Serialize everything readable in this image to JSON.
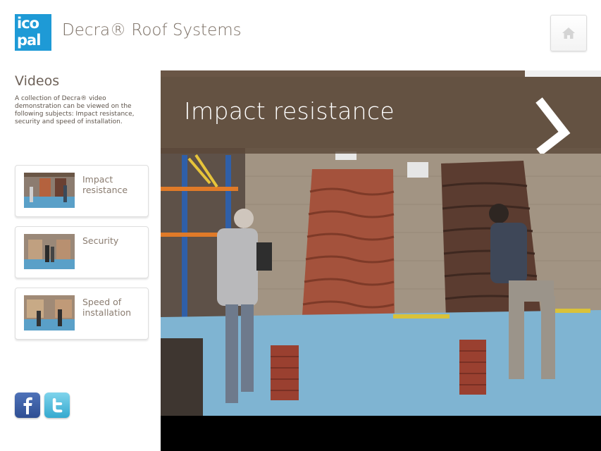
{
  "header": {
    "logo_line1": "ico",
    "logo_line2": "pal",
    "app_title": "Decra® Roof Systems",
    "home_icon": "home-icon"
  },
  "sidebar": {
    "title": "Videos",
    "description": "A collection of Decra® video demonstration can be viewed on the following subjects: Impact resistance, security and speed of installation.",
    "items": [
      {
        "label": "Impact resistance"
      },
      {
        "label": "Security"
      },
      {
        "label": "Speed of installation"
      }
    ],
    "social": [
      {
        "icon": "facebook-icon"
      },
      {
        "icon": "twitter-icon"
      }
    ]
  },
  "player": {
    "title": "Impact resistance",
    "next_icon": "chevron-right-icon"
  },
  "colors": {
    "logo_blue": "#1e9ad6",
    "title_bar": "#5c4838",
    "text_brown": "#6a5f55",
    "floor_blue": "#7fb4d2"
  }
}
